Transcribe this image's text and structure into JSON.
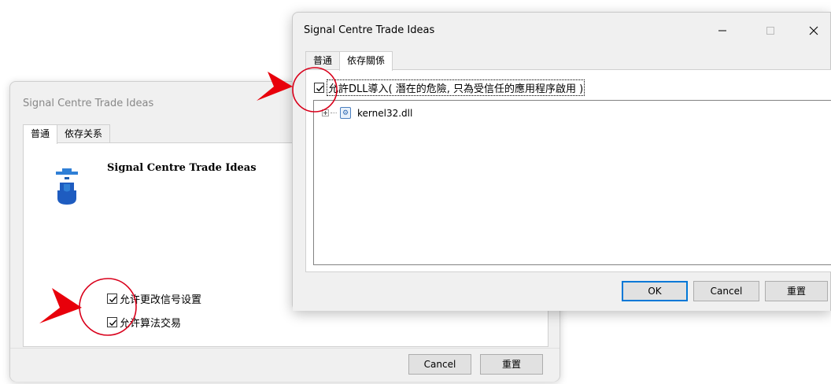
{
  "back_dialog": {
    "title": "Signal Centre Trade Ideas",
    "tabs": [
      "普通",
      "依存关系"
    ],
    "app_name": "Signal Centre Trade Ideas",
    "checkbox_allow_signal_settings": "允许更改信号设置",
    "checkbox_allow_algo_trading": "允许算法交易",
    "cancel_label": "Cancel",
    "reset_label": "重置"
  },
  "front_dialog": {
    "title": "Signal Centre Trade Ideas",
    "minimize_icon": "minimize-icon",
    "maximize_icon": "maximize-icon",
    "close_icon": "close-icon",
    "tabs": [
      "普通",
      "依存關係"
    ],
    "checkbox_allow_dll": "允許DLL導入( 潛在的危險, 只為受信任的應用程序啟用 )",
    "dependencies": [
      {
        "name": "kernel32.dll",
        "icon": "dll-gear-icon"
      }
    ],
    "ok_label": "OK",
    "cancel_label": "Cancel",
    "reset_label": "重置"
  },
  "annotation_colors": {
    "arrow": "#e8000b",
    "circle": "#d9001b"
  }
}
